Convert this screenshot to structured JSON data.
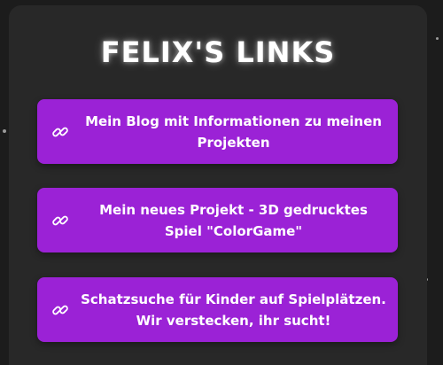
{
  "page": {
    "title": "FELIX'S LINKS"
  },
  "links": [
    {
      "label": "Mein Blog mit Informationen zu meinen Projekten",
      "icon": "link-icon"
    },
    {
      "label": "Mein neues Projekt - 3D gedrucktes Spiel \"ColorGame\"",
      "icon": "link-icon"
    },
    {
      "label": "Schatzsuche für Kinder auf Spielplätzen. Wir verstecken, ihr sucht!",
      "icon": "link-icon"
    }
  ],
  "colors": {
    "background": "#1c1c1c",
    "card": "#282828",
    "button": "#9b22d6",
    "text": "#ffffff"
  }
}
